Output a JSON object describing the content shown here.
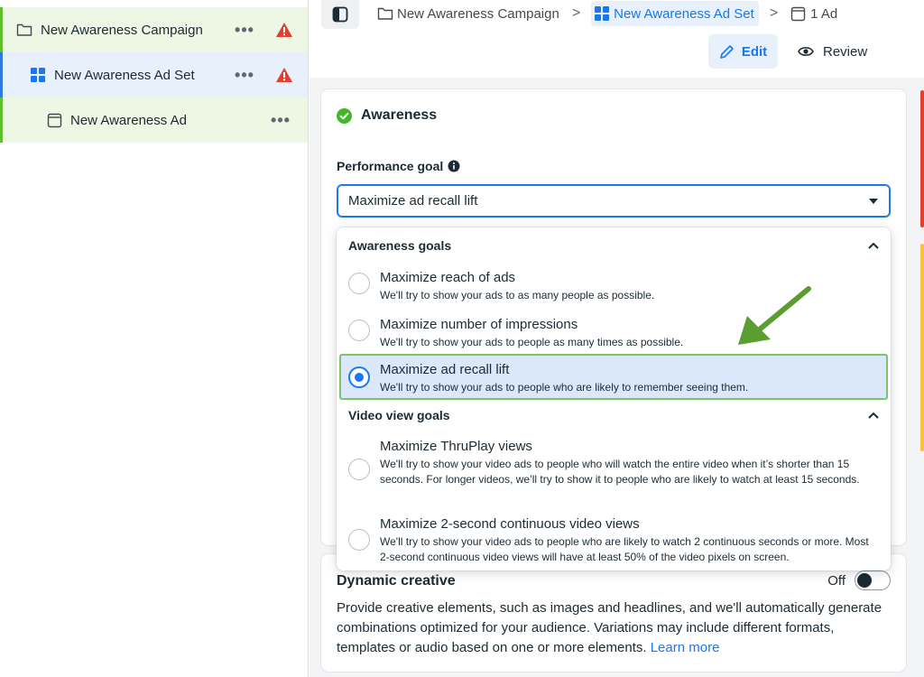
{
  "sidebar": {
    "campaign": {
      "label": "New Awareness Campaign",
      "more": "•••"
    },
    "adset": {
      "label": "New Awareness Ad Set",
      "more": "•••"
    },
    "ad": {
      "label": "New Awareness Ad",
      "more": "•••"
    }
  },
  "breadcrumb": {
    "campaign": "New Awareness Campaign",
    "adset": "New Awareness Ad Set",
    "ad": "1 Ad",
    "separator": ">"
  },
  "header": {
    "edit_label": "Edit",
    "review_label": "Review"
  },
  "objective": {
    "title": "Awareness",
    "performance_goal_label": "Performance goal",
    "selected_value": "Maximize ad recall lift"
  },
  "dropdown": {
    "awareness_group": {
      "title": "Awareness goals",
      "options": [
        {
          "title": "Maximize reach of ads",
          "desc": "We'll try to show your ads to as many people as possible."
        },
        {
          "title": "Maximize number of impressions",
          "desc": "We'll try to show your ads to people as many times as possible."
        },
        {
          "title": "Maximize ad recall lift",
          "desc": "We'll try to show your ads to people who are likely to remember seeing them."
        }
      ]
    },
    "video_group": {
      "title": "Video view goals",
      "options": [
        {
          "title": "Maximize ThruPlay views",
          "desc": "We'll try to show your video ads to people who will watch the entire video when it’s shorter than 15 seconds. For longer videos, we’ll try to show it to people who are likely to watch at least 15 seconds."
        },
        {
          "title": "Maximize 2-second continuous video views",
          "desc": "We'll try to show your video ads to people who are likely to watch 2 continuous seconds or more. Most 2-second continuous video views will have at least 50% of the video pixels on screen."
        }
      ]
    }
  },
  "dynamic_creative": {
    "title": "Dynamic creative",
    "toggle_label": "Off",
    "description": "Provide creative elements, such as images and headlines, and we'll automatically generate combinations optimized for your audience. Variations may include different formats, templates or audio based on one or more elements. ",
    "learn_more": "Learn more"
  },
  "colors": {
    "accent": "#1877f2",
    "success": "#42b72a",
    "warning": "#e0402f",
    "annotation_arrow": "#5a9e32"
  }
}
